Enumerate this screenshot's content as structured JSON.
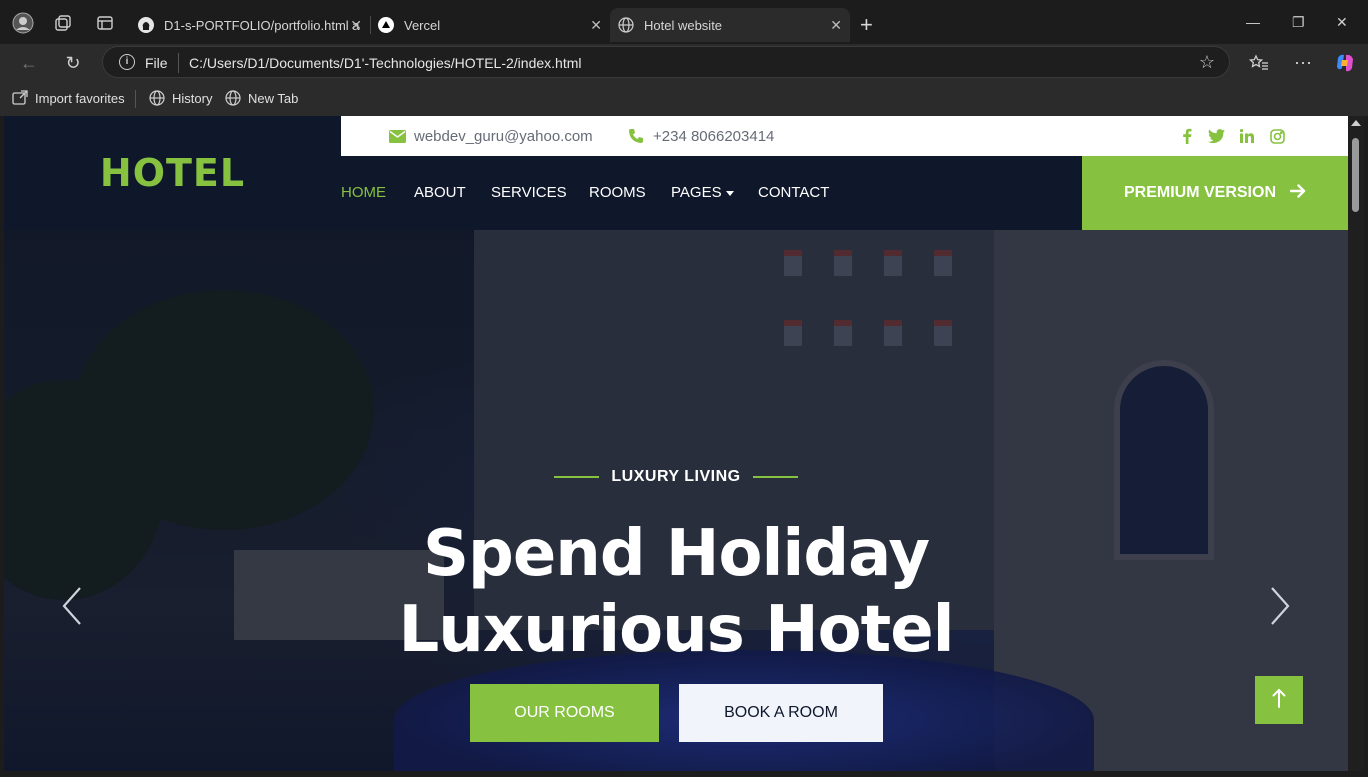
{
  "browser": {
    "tabs": [
      {
        "title": "D1-s-PORTFOLIO/portfolio.html a",
        "icon": "github-icon"
      },
      {
        "title": "Vercel",
        "icon": "vercel-icon"
      },
      {
        "title": "Hotel website",
        "icon": "globe-icon",
        "active": true
      }
    ],
    "new_tab": "+",
    "address": {
      "scheme_label": "File",
      "url": "C:/Users/D1/Documents/D1'-Technologies/HOTEL-2/index.html"
    },
    "favorites": [
      {
        "label": "Import favorites",
        "icon": "import-icon"
      },
      {
        "label": "History",
        "icon": "globe-icon"
      },
      {
        "label": "New Tab",
        "icon": "globe-icon"
      }
    ]
  },
  "site": {
    "brand": "HOTEL",
    "topbar": {
      "email": "webdev_guru@yahoo.com",
      "phone": "+234 8066203414",
      "socials": [
        "facebook-icon",
        "twitter-icon",
        "linkedin-icon",
        "instagram-icon"
      ]
    },
    "nav": {
      "items": [
        "HOME",
        "ABOUT",
        "SERVICES",
        "ROOMS",
        "PAGES",
        "CONTACT"
      ],
      "active": "HOME",
      "premium": "PREMIUM VERSION"
    },
    "hero": {
      "kicker": "LUXURY LIVING",
      "line1": "Spend Holiday",
      "line2": "Luxurious Hotel",
      "primary_btn": "OUR ROOMS",
      "secondary_btn": "BOOK A ROOM"
    },
    "colors": {
      "accent": "#86c140",
      "navy": "#0f172b"
    }
  }
}
